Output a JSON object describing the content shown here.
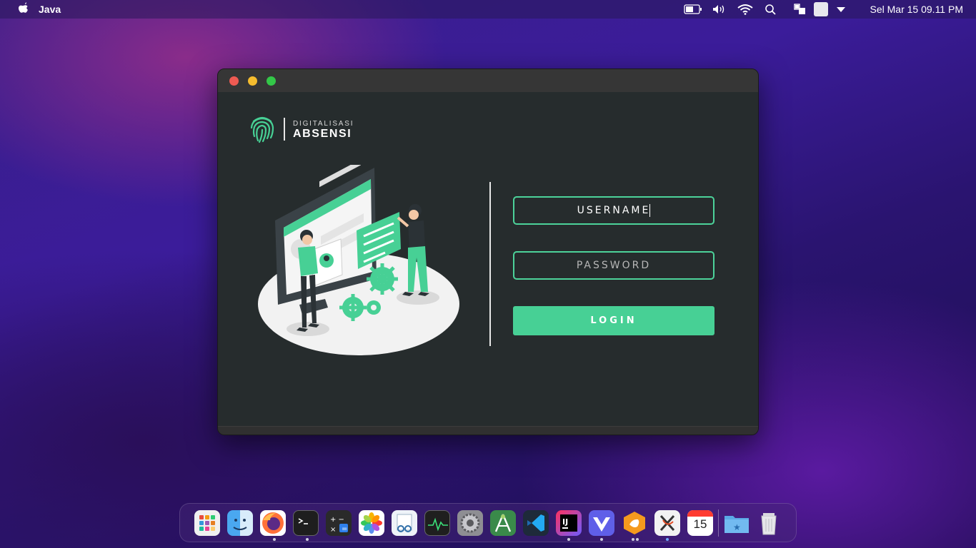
{
  "menubar": {
    "app_name": "Java",
    "clock": "Sel Mar 15  09.11 PM"
  },
  "window": {
    "brand": {
      "subtitle": "DIGITALISASI",
      "title": "ABSENSI"
    },
    "form": {
      "username_value": "USERNAME",
      "password_placeholder": "PASSWORD",
      "login_label": "LOGIN"
    }
  },
  "colors": {
    "accent": "#47d095",
    "window_bg": "#262c2d",
    "titlebar": "#363636"
  },
  "dock": {
    "apps": [
      {
        "name": "launchpad",
        "icon": "launchpad-icon",
        "running": false
      },
      {
        "name": "finder",
        "icon": "finder-icon",
        "running": true
      },
      {
        "name": "firefox",
        "icon": "firefox-icon",
        "running": false
      },
      {
        "name": "terminal",
        "icon": "terminal-icon",
        "running": true
      },
      {
        "name": "calculator",
        "icon": "calculator-icon",
        "running": false
      },
      {
        "name": "photos",
        "icon": "photos-icon",
        "running": false
      },
      {
        "name": "preview",
        "icon": "preview-icon",
        "running": false
      },
      {
        "name": "activity-monitor",
        "icon": "activity-monitor-icon",
        "running": false
      },
      {
        "name": "system-preferences",
        "icon": "settings-icon",
        "running": false
      },
      {
        "name": "android-studio",
        "icon": "android-studio-icon",
        "running": false
      },
      {
        "name": "vscode",
        "icon": "vscode-icon",
        "running": false
      },
      {
        "name": "intellij",
        "icon": "intellij-icon",
        "running": true
      },
      {
        "name": "vectorize",
        "icon": "vectorize-icon",
        "running": true
      },
      {
        "name": "hand-app",
        "icon": "hand-icon",
        "running": true
      },
      {
        "name": "xampp",
        "icon": "xampp-icon",
        "running": true
      },
      {
        "name": "calendar",
        "icon": "calendar-icon",
        "running": false,
        "label": "15"
      },
      {
        "name": "downloads",
        "icon": "folder-icon",
        "running": false
      },
      {
        "name": "trash",
        "icon": "trash-icon",
        "running": false
      }
    ]
  }
}
